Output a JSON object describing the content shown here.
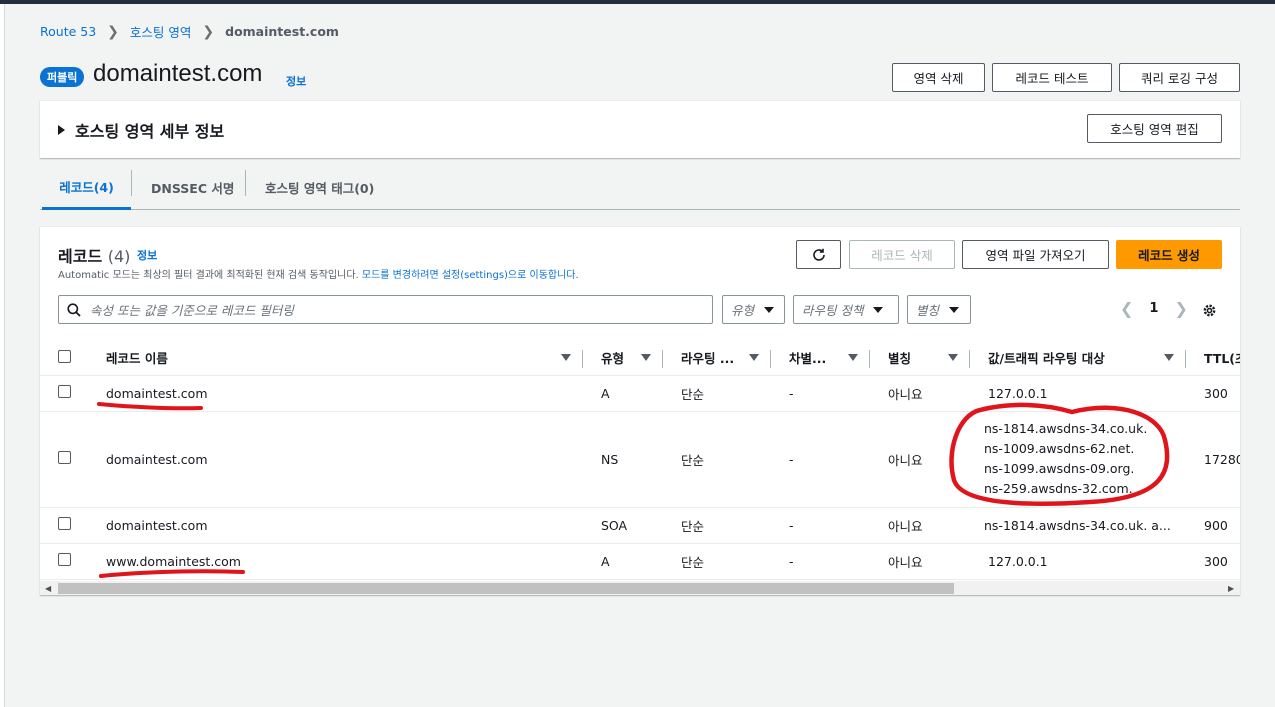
{
  "breadcrumb": {
    "items": [
      "Route 53",
      "호스팅 영역",
      "domaintest.com"
    ]
  },
  "header": {
    "badge": "퍼블릭",
    "title": "domaintest.com",
    "info": "정보",
    "buttons": {
      "delete_zone": "영역 삭제",
      "test_record": "레코드 테스트",
      "query_logging": "쿼리 로깅 구성"
    }
  },
  "details": {
    "title": "호스팅 영역 세부 정보",
    "edit_button": "호스팅 영역 편집"
  },
  "tabs": [
    "레코드(4)",
    "DNSSEC 서명",
    "호스팅 영역 태그(0)"
  ],
  "records": {
    "title": "레코드",
    "count": "(4)",
    "info": "정보",
    "desc": "Automatic 모드는 최상의 필터 결과에 최적화된 현재 검색 동작입니다.",
    "desc_link": "모드를 변경하려면 설정(settings)으로 이동합니다.",
    "buttons": {
      "delete": "레코드 삭제",
      "import": "영역 파일 가져오기",
      "create": "레코드 생성"
    },
    "filter_placeholder": "속성 또는 값을 기준으로 레코드 필터링",
    "filters": [
      "유형",
      "라우팅 정책",
      "별칭"
    ],
    "page": "1",
    "columns": [
      "레코드 이름",
      "유형",
      "라우팅 ...",
      "차별...",
      "별칭",
      "값/트래픽 라우팅 대상",
      "TTL(초"
    ],
    "rows": [
      {
        "name": "domaintest.com",
        "type": "A",
        "routing": "단순",
        "diff": "-",
        "alias": "아니요",
        "value": [
          "127.0.0.1"
        ],
        "ttl": "300"
      },
      {
        "name": "domaintest.com",
        "type": "NS",
        "routing": "단순",
        "diff": "-",
        "alias": "아니요",
        "value": [
          "ns-1814.awsdns-34.co.uk.",
          "ns-1009.awsdns-62.net.",
          "ns-1099.awsdns-09.org.",
          "ns-259.awsdns-32.com."
        ],
        "ttl": "17280"
      },
      {
        "name": "domaintest.com",
        "type": "SOA",
        "routing": "단순",
        "diff": "-",
        "alias": "아니요",
        "value": [
          "ns-1814.awsdns-34.co.uk. a..."
        ],
        "ttl": "900"
      },
      {
        "name": "www.domaintest.com",
        "type": "A",
        "routing": "단순",
        "diff": "-",
        "alias": "아니요",
        "value": [
          "127.0.0.1"
        ],
        "ttl": "300"
      }
    ]
  },
  "colors": {
    "accent": "#0972d3",
    "primary_button": "#ff9900",
    "annotation": "#e0141b"
  }
}
